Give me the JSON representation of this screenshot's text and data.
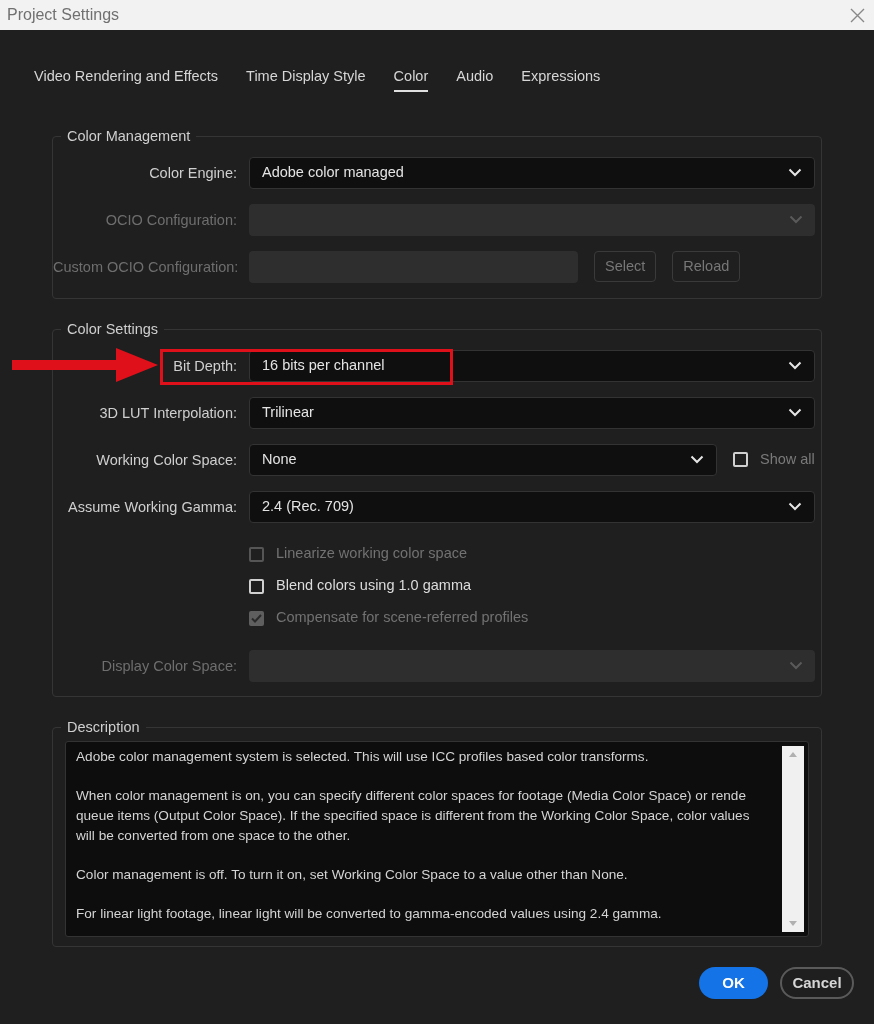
{
  "window": {
    "title": "Project Settings"
  },
  "tabs": [
    {
      "label": "Video Rendering and Effects",
      "selected": false
    },
    {
      "label": "Time Display Style",
      "selected": false
    },
    {
      "label": "Color",
      "selected": true
    },
    {
      "label": "Audio",
      "selected": false
    },
    {
      "label": "Expressions",
      "selected": false
    }
  ],
  "color_management": {
    "title": "Color Management",
    "rows": [
      {
        "kind": "dropdown",
        "label": "Color Engine:",
        "value": "Adobe color managed",
        "disabled": false,
        "highlighted": false
      },
      {
        "kind": "dropdown",
        "label": "OCIO Configuration:",
        "disabled": true,
        "highlighted": false
      },
      {
        "kind": "path",
        "label": "Custom OCIO Configuration:",
        "disabled": true,
        "buttons": [
          "Select",
          "Reload"
        ]
      }
    ]
  },
  "color_settings": {
    "title": "Color Settings",
    "rows": [
      {
        "kind": "dropdown",
        "label": "Bit Depth:",
        "value": "16 bits per channel",
        "disabled": false,
        "highlighted": true
      },
      {
        "kind": "dropdown",
        "label": "3D LUT Interpolation:",
        "value": "Trilinear",
        "disabled": false,
        "highlighted": false
      },
      {
        "kind": "dropdown_check",
        "label": "Working Color Space:",
        "value": "None",
        "disabled": false,
        "highlighted": false,
        "check": {
          "label": "Show all",
          "checked": false
        }
      },
      {
        "kind": "dropdown",
        "label": "Assume Working Gamma:",
        "value": "2.4 (Rec. 709)",
        "disabled": false,
        "highlighted": false
      },
      {
        "kind": "checkbox",
        "label": "Linearize working color space",
        "checked": false,
        "disabled": true
      },
      {
        "kind": "checkbox",
        "label": "Blend colors using 1.0 gamma",
        "checked": false,
        "disabled": false
      },
      {
        "kind": "checkbox",
        "label": "Compensate for scene-referred profiles",
        "checked": true,
        "disabled": true
      },
      {
        "kind": "dropdown",
        "label": "Display Color Space:",
        "disabled": true,
        "highlighted": false
      }
    ]
  },
  "description": {
    "title": "Description",
    "paragraphs": [
      [
        "Adobe color management system is selected. This will use ICC profiles based color transforms."
      ],
      [
        "When color management is on, you can specify different color spaces for footage (Media Color Space) or rende",
        "queue items (Output Color Space). If the specified space is different from the Working Color Space, color values",
        "will be converted from one space to the other."
      ],
      [
        "Color management is off. To turn it on, set Working Color Space to a value other than None."
      ],
      [
        "For linear light footage, linear light will be converted to gamma-encoded values using 2.4 gamma."
      ]
    ]
  },
  "buttons": [
    {
      "label": "OK",
      "kind": "primary"
    },
    {
      "label": "Cancel",
      "kind": "secondary"
    }
  ]
}
